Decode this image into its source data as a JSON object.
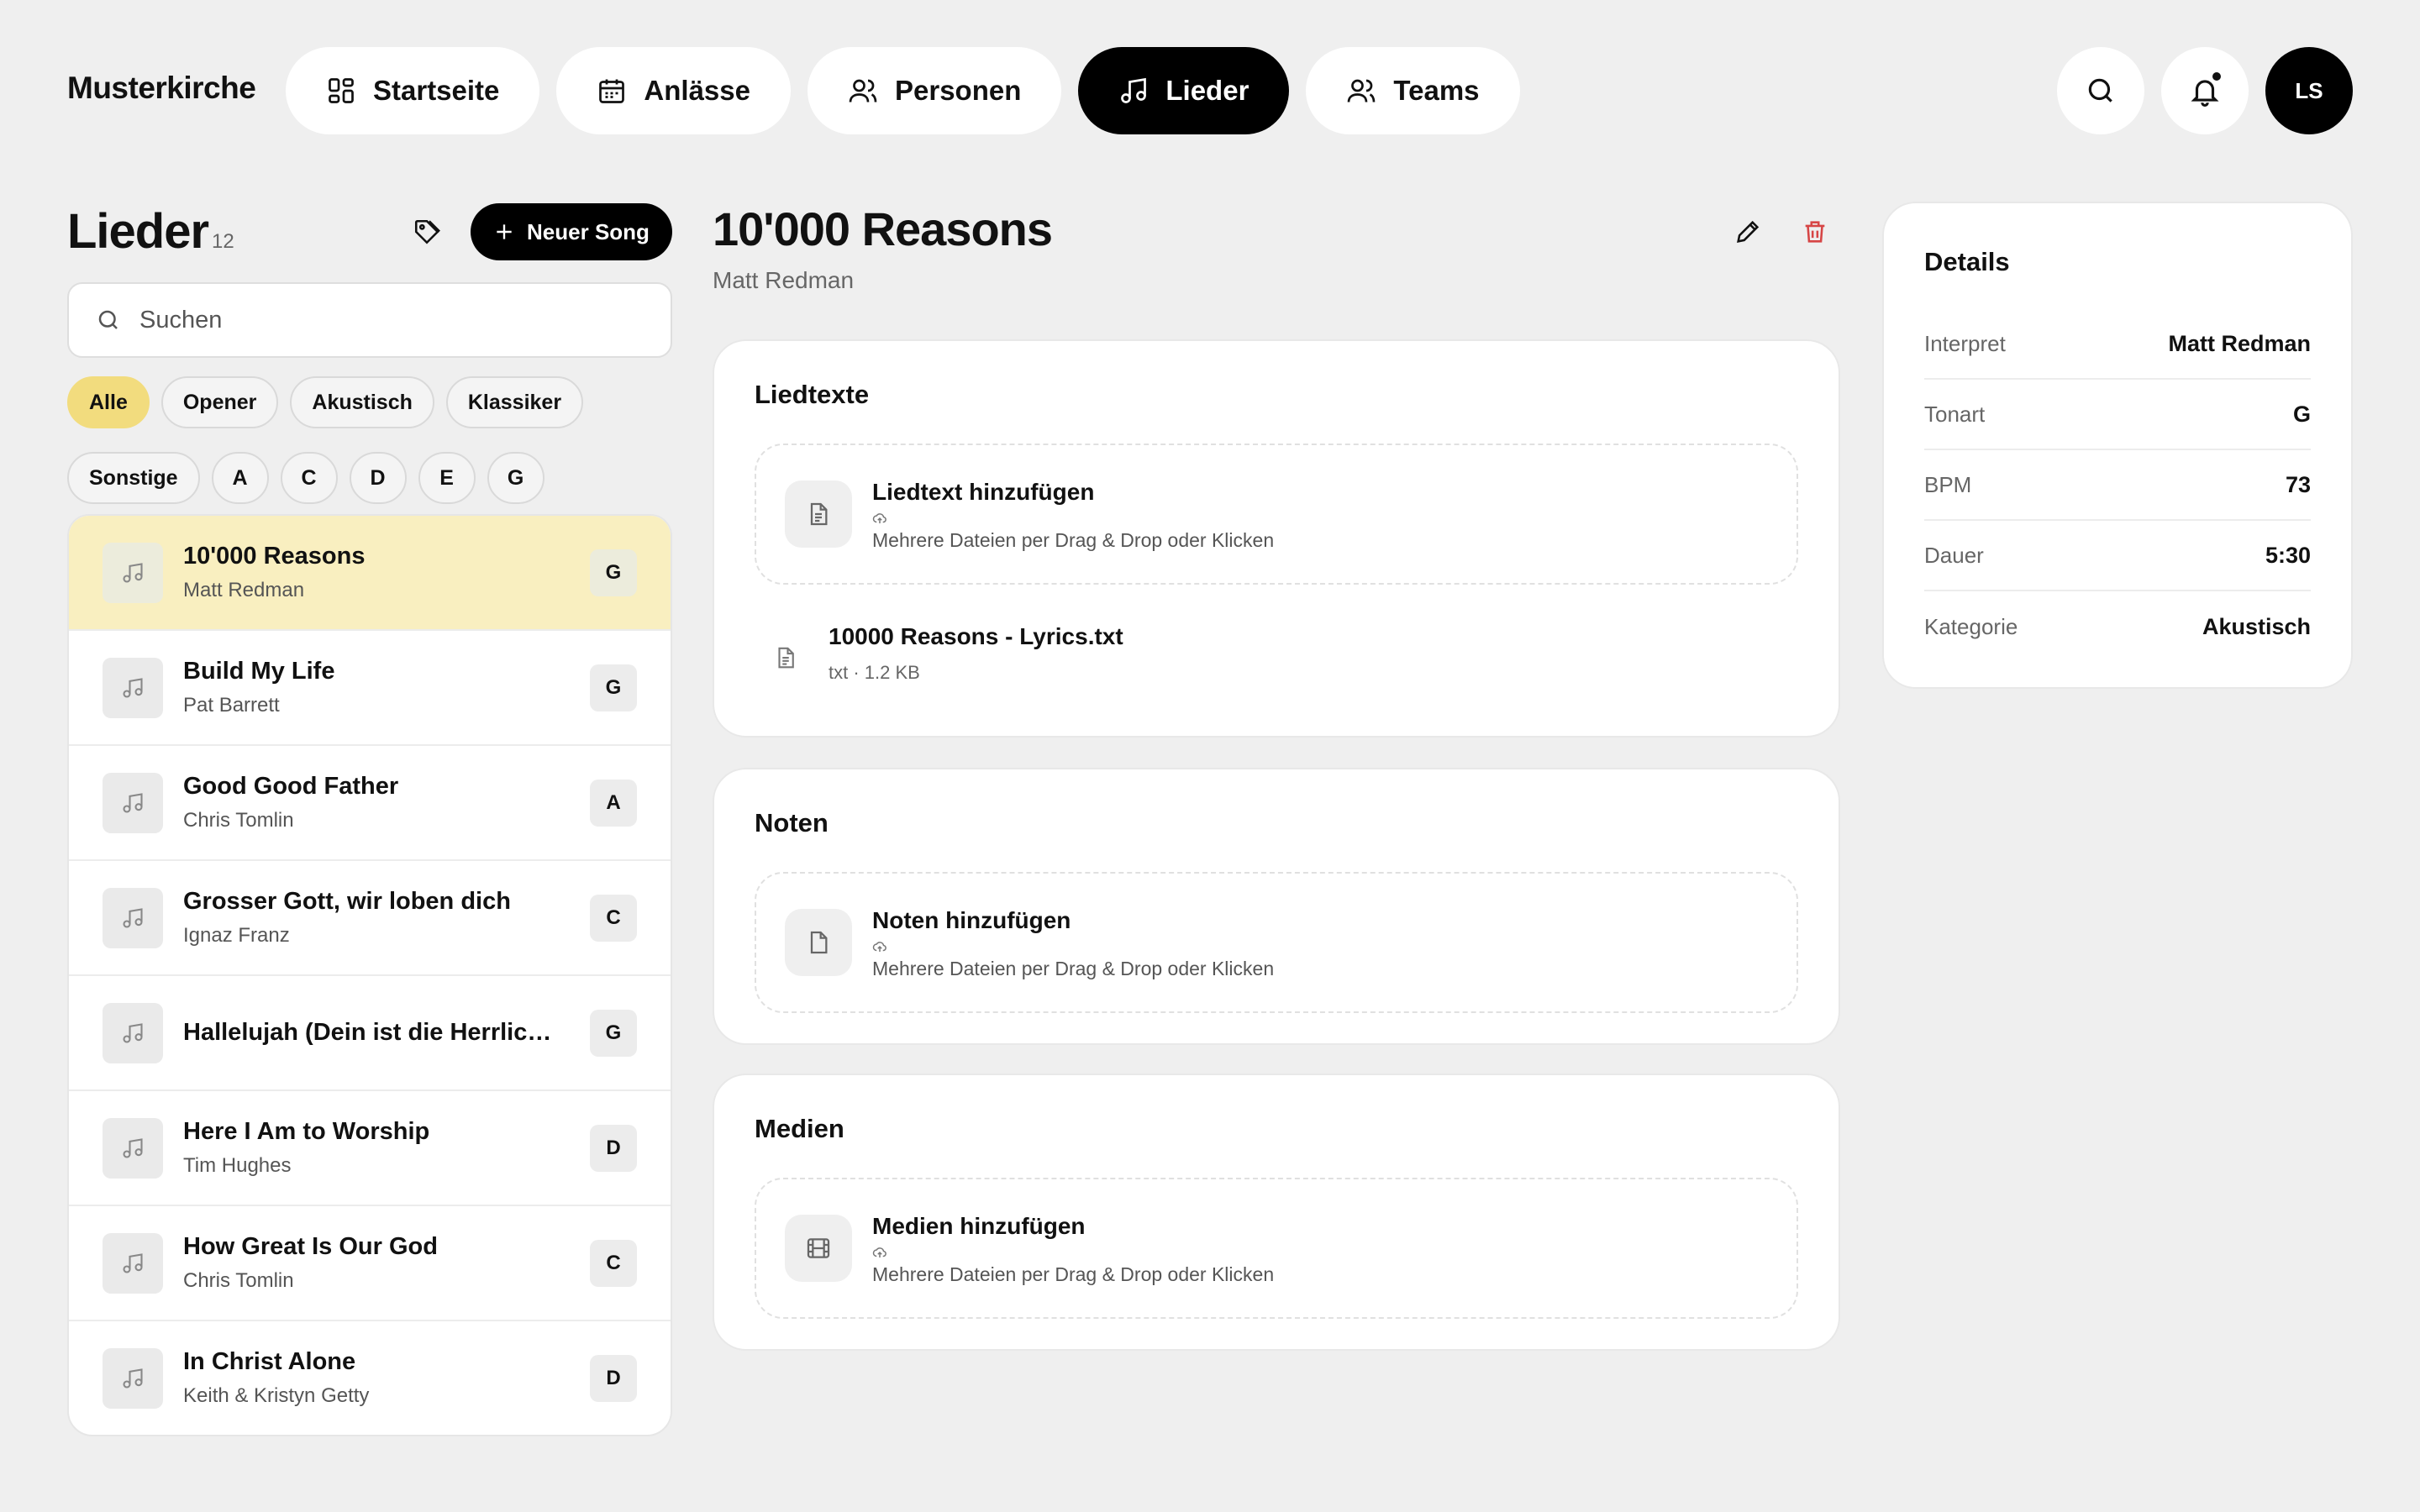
{
  "brand": "Musterkirche",
  "nav": [
    {
      "label": "Startseite",
      "icon": "dashboard-icon"
    },
    {
      "label": "Anlässe",
      "icon": "calendar-icon"
    },
    {
      "label": "Personen",
      "icon": "people-icon"
    },
    {
      "label": "Lieder",
      "icon": "music-note-icon",
      "active": true
    },
    {
      "label": "Teams",
      "icon": "people-icon"
    }
  ],
  "header": {
    "avatar_initials": "LS",
    "has_notification": true
  },
  "songs_panel": {
    "title": "Lieder",
    "count": "12",
    "new_song_label": "Neuer Song",
    "search_placeholder": "Suchen",
    "filters": [
      "Alle",
      "Opener",
      "Akustisch",
      "Klassiker",
      "Sonstige",
      "A",
      "C",
      "D",
      "E",
      "G"
    ],
    "active_filter": "Alle",
    "songs": [
      {
        "title": "10'000 Reasons",
        "artist": "Matt Redman",
        "key": "G",
        "active": true
      },
      {
        "title": "Build My Life",
        "artist": "Pat Barrett",
        "key": "G"
      },
      {
        "title": "Good Good Father",
        "artist": "Chris Tomlin",
        "key": "A"
      },
      {
        "title": "Grosser Gott, wir loben dich",
        "artist": "Ignaz Franz",
        "key": "C"
      },
      {
        "title": "Hallelujah (Dein ist die Herrlichke...",
        "artist": "",
        "key": "G"
      },
      {
        "title": "Here I Am to Worship",
        "artist": "Tim Hughes",
        "key": "D"
      },
      {
        "title": "How Great Is Our God",
        "artist": "Chris Tomlin",
        "key": "C"
      },
      {
        "title": "In Christ Alone",
        "artist": "Keith & Kristyn Getty",
        "key": "D"
      }
    ]
  },
  "song_detail": {
    "title": "10'000 Reasons",
    "artist": "Matt Redman",
    "sections": {
      "lyrics": {
        "title": "Liedtexte",
        "upload_title": "Liedtext hinzufügen",
        "upload_hint": "Mehrere Dateien per Drag & Drop oder Klicken",
        "file_name": "10000 Reasons - Lyrics.txt",
        "file_meta": "txt · 1.2 KB"
      },
      "sheets": {
        "title": "Noten",
        "upload_title": "Noten hinzufügen",
        "upload_hint": "Mehrere Dateien per Drag & Drop oder Klicken"
      },
      "media": {
        "title": "Medien",
        "upload_title": "Medien hinzufügen",
        "upload_hint": "Mehrere Dateien per Drag & Drop oder Klicken"
      }
    }
  },
  "details": {
    "title": "Details",
    "rows": [
      {
        "label": "Interpret",
        "value": "Matt Redman"
      },
      {
        "label": "Tonart",
        "value": "G"
      },
      {
        "label": "BPM",
        "value": "73"
      },
      {
        "label": "Dauer",
        "value": "5:30"
      },
      {
        "label": "Kategorie",
        "value": "Akustisch"
      }
    ]
  },
  "colors": {
    "accent": "#f2dc7e",
    "selected_row": "#f9efc0",
    "danger": "#d64545",
    "dark": "#000000"
  }
}
